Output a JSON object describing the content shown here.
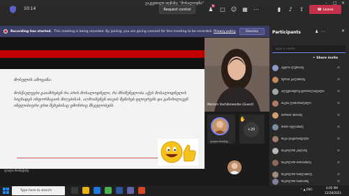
{
  "window": {
    "title": "გაკვეთილი თემაზე: \"მოსალოდნა\""
  },
  "toolbar": {
    "timer": "10:14",
    "request_control": "Request control",
    "chat_badge": "9",
    "leave": "Leave",
    "accent": "#c4314b"
  },
  "banner": {
    "title": "Recording has started.",
    "text": "This meeting is being recorded. By joining, you are giving consent for this meeting to be recorded.",
    "link": "Privacy policy",
    "dismiss": "Dismiss"
  },
  "slide": {
    "heading": "მოსვლის ამოცანა:",
    "body": "მოსწავლეები გაიაზრებენ რა არის მოსალოდნელი, რა მნიშვნელობა აქვს მოსალოდნელის სიცხადეს ინფორმაციის მიღებისას, აღმოაჩენენ თავის შემახებ ფლიერებს და განიხილავენ ინფლიბიური ერთ შეხებისაც უმოხრიტ მსჯელობებს.",
    "presenter": "ლალი რობაქიძე"
  },
  "video": {
    "name": "Mariam Vachibmeadze (Guest)",
    "avatar_name": "ლალი რობაქ...",
    "more_count": "+20"
  },
  "panel": {
    "title": "Participants",
    "search_placeholder": "Type a name",
    "share_invite": "Share invite",
    "participants": [
      "ავტოა ლებიაძე",
      "ზურაბ გალინიძე",
      "ალექსანდრე ტოროლაშვილი",
      "მაკნა ლაზარიშვილი",
      "მარიამ ანთაძე",
      "ნინო სულამიძე",
      "ნიკა დავითაშვილი",
      "ნიკოლოზ კილაძე",
      "ნიკოლოზ მარიამიძე",
      "ნიკოლოზ სასლანიძე",
      "ნიკოლოზ სამიაბძე",
      "ნიკოლოზ ბერაბიძე"
    ]
  },
  "taskbar": {
    "search_placeholder": "Type here to search",
    "time": "4:05 PM",
    "date": "12/28/2021",
    "lang": "ENG"
  }
}
